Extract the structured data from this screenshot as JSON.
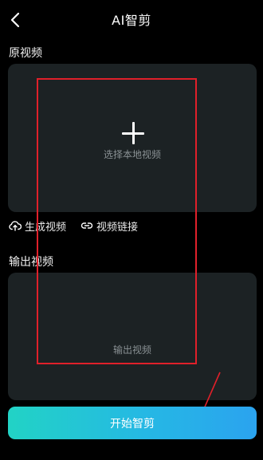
{
  "header": {
    "title": "AI智剪",
    "back_icon": "chevron-left-icon"
  },
  "source_section": {
    "label": "原视频",
    "upload_icon": "plus-icon",
    "upload_text": "选择本地视频"
  },
  "actions": [
    {
      "label": "生成视频",
      "icon": "cloud-upload-icon"
    },
    {
      "label": "视频链接",
      "icon": "link-icon"
    }
  ],
  "output_section": {
    "label": "输出视频",
    "placeholder": "输出视频"
  },
  "primary_button": {
    "label": "开始智剪"
  },
  "colors": {
    "background": "#000000",
    "panel": "#1c2224",
    "annotation": "#e0202a",
    "button_gradient_start": "#22d3c5",
    "button_gradient_end": "#2ba3ef"
  }
}
